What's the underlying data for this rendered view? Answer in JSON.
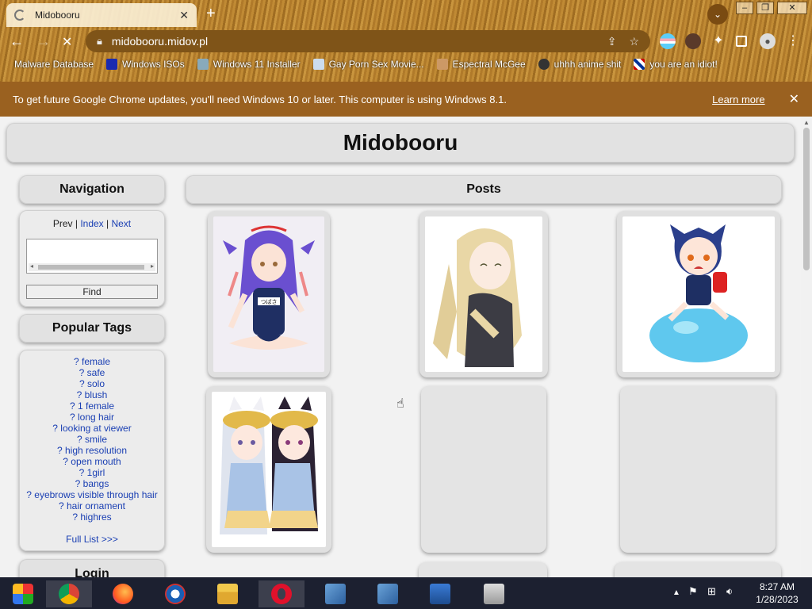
{
  "browser": {
    "tab_title": "Midobooru",
    "url": "midobooru.midov.pl",
    "bookmarks": [
      "Malware Database",
      "Windows ISOs",
      "Windows 11 Installer",
      "Gay Porn Sex Movie...",
      "Espectral McGee",
      "uhhh anime shit",
      "you are an idiot!"
    ]
  },
  "infobar": {
    "message": "To get future Google Chrome updates, you'll need Windows 10 or later. This computer is using Windows 8.1.",
    "learn_more": "Learn more"
  },
  "site": {
    "title": "Midobooru"
  },
  "navigation": {
    "header": "Navigation",
    "prev": "Prev",
    "sep1": " | ",
    "index": "Index",
    "sep2": " | ",
    "next": "Next",
    "search_value": "",
    "find_label": "Find"
  },
  "popular_tags": {
    "header": "Popular Tags",
    "tags": [
      "? female",
      "? safe",
      "? solo",
      "? blush",
      "? 1 female",
      "? long hair",
      "? looking at viewer",
      "? smile",
      "? high resolution",
      "? open mouth",
      "? 1girl",
      "? bangs",
      "? eyebrows visible through hair",
      "? hair ornament",
      "? highres"
    ],
    "full_list": "Full List >>>"
  },
  "login": {
    "header": "Login"
  },
  "posts": {
    "header": "Posts",
    "name_tag_text": "つばさ"
  },
  "taskbar": {
    "time": "8:27 AM",
    "date": "1/28/2023"
  }
}
